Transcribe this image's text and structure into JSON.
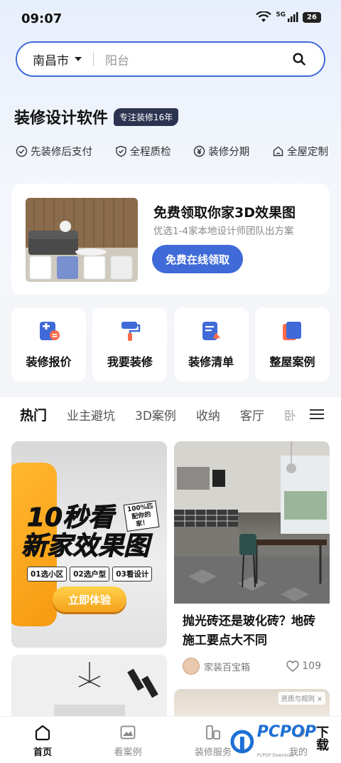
{
  "status": {
    "time": "09:07",
    "network": "5G",
    "battery": "26"
  },
  "search": {
    "city": "南昌市",
    "placeholder": "阳台"
  },
  "brand": {
    "title": "装修设计软件",
    "badge": "专注装修16年"
  },
  "features": [
    {
      "icon": "check-circle-icon",
      "label": "先装修后支付"
    },
    {
      "icon": "shield-check-icon",
      "label": "全程质检"
    },
    {
      "icon": "yen-circle-icon",
      "label": "装修分期"
    },
    {
      "icon": "house-icon",
      "label": "全屋定制"
    }
  ],
  "promo": {
    "title": "免费领取你家3D效果图",
    "subtitle": "优选1-4家本地设计师团队出方案",
    "button": "免费在线领取"
  },
  "quick_actions": [
    {
      "icon": "calculator-icon",
      "label": "装修报价",
      "color": "#3f6ad8"
    },
    {
      "icon": "paint-roller-icon",
      "label": "我要装修",
      "color": "#3f6ad8"
    },
    {
      "icon": "checklist-icon",
      "label": "装修清单",
      "color": "#3f6ad8"
    },
    {
      "icon": "book-icon",
      "label": "整屋案例",
      "color": "#3f6ad8"
    }
  ],
  "tabs": [
    "热门",
    "业主避坑",
    "3D案例",
    "收纳",
    "客厅",
    "卧"
  ],
  "ad_card": {
    "line1": "10秒看",
    "line2": "新家效果图",
    "tag": "100%匹配你的家！",
    "steps": [
      "01选小区",
      "02选户型",
      "03看设计"
    ],
    "button": "立即体验"
  },
  "article_card": {
    "title": "抛光砖还是玻化砖？地砖施工要点大不同",
    "author": "家装百宝箱",
    "likes": "109"
  },
  "qualification_tag": "资质与规则",
  "bottom_nav": [
    {
      "icon": "home-icon",
      "label": "首页",
      "active": true
    },
    {
      "icon": "image-icon",
      "label": "看案例",
      "active": false
    },
    {
      "icon": "service-icon",
      "label": "装修服务",
      "active": false
    },
    {
      "icon": "user-icon",
      "label": "我的",
      "active": false
    }
  ],
  "watermark": {
    "logo": "PCPOP",
    "text": "下载",
    "sub": "PCPOP Download"
  },
  "colors": {
    "accent": "#3f6ad8",
    "badge_bg": "#2c3350",
    "cta_orange": "#f4a21b"
  }
}
